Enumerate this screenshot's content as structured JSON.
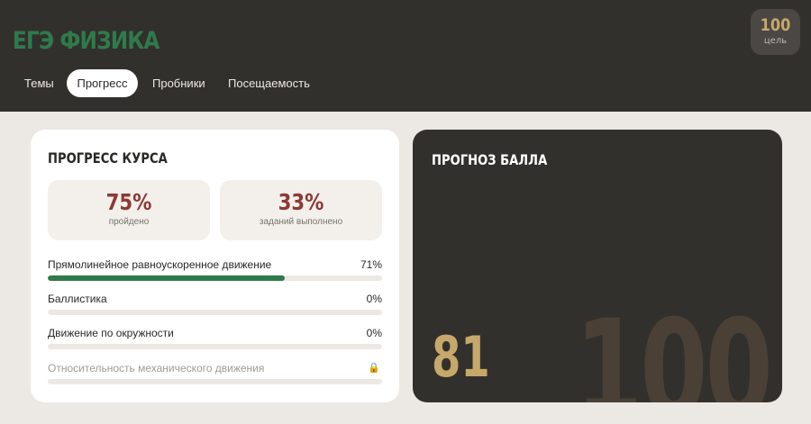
{
  "app": {
    "brand": "ЕГЭ ФИЗИКА"
  },
  "goal": {
    "value": "100",
    "label": "цель"
  },
  "tabs": [
    {
      "label": "Темы",
      "active": false
    },
    {
      "label": "Прогресс",
      "active": true
    },
    {
      "label": "Пробники",
      "active": false
    },
    {
      "label": "Посещаемость",
      "active": false
    }
  ],
  "progress": {
    "title": "ПРОГРЕСС КУРСА",
    "stats": [
      {
        "value": "75%",
        "label": "пройдено"
      },
      {
        "value": "33%",
        "label": "заданий выполнено"
      }
    ],
    "topics": [
      {
        "name": "Прямолинейное равноускоренное движение",
        "percent": "71%",
        "value": 71,
        "locked": false
      },
      {
        "name": "Баллистика",
        "percent": "0%",
        "value": 0,
        "locked": false
      },
      {
        "name": "Движение по окружности",
        "percent": "0%",
        "value": 0,
        "locked": false
      },
      {
        "name": "Относительность механического движения",
        "value": 0,
        "locked": true,
        "icon": "lock-icon"
      }
    ]
  },
  "forecast": {
    "title": "ПРОГНОЗ БАЛЛА",
    "score": "81",
    "max": "100"
  },
  "colors": {
    "accent_green": "#2f7a4c",
    "accent_gold": "#c6a86a",
    "accent_red": "#8e3a34",
    "dark": "#32302d"
  }
}
